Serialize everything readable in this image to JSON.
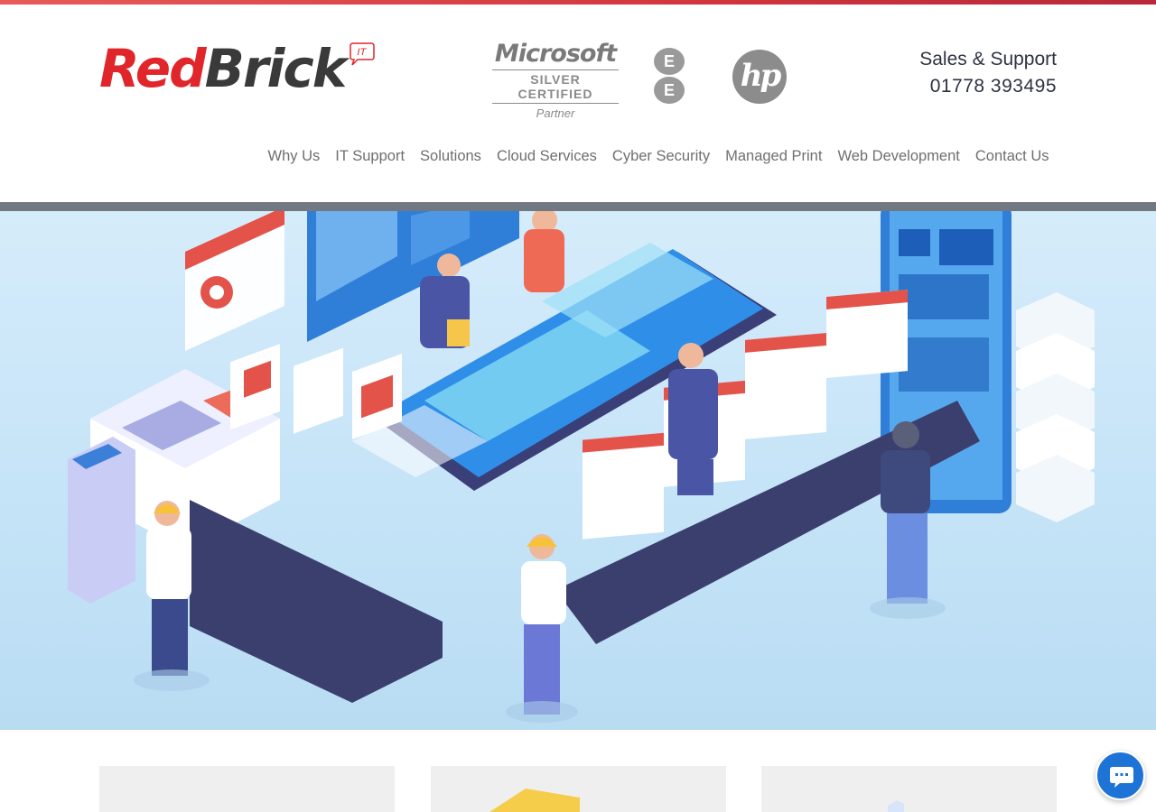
{
  "brand": {
    "logo_part1": "Red",
    "logo_part2": "Brick",
    "logo_badge": "IT"
  },
  "partners": {
    "microsoft_name": "Microsoft",
    "microsoft_level": "SILVER CERTIFIED",
    "microsoft_partner": "Partner",
    "ee_letter_top": "E",
    "ee_letter_bottom": "E",
    "hp_text": "hp"
  },
  "contact": {
    "label": "Sales & Support",
    "phone": "01778 393495"
  },
  "nav": {
    "items": [
      {
        "label": "Why Us"
      },
      {
        "label": "IT Support"
      },
      {
        "label": "Solutions"
      },
      {
        "label": "Cloud Services"
      },
      {
        "label": "Cyber Security"
      },
      {
        "label": "Managed Print"
      },
      {
        "label": "Web Development"
      },
      {
        "label": "Contact Us"
      }
    ]
  },
  "colors": {
    "brand_red": "#e0262b",
    "brand_dark": "#3a3a3a",
    "nav_text": "#6f6f6f",
    "contact_text": "#2f3243",
    "hero_bg": "#c4e3f7",
    "chat_button": "#1e73d6"
  },
  "icons": {
    "chat": "chat-bubble-icon",
    "hero": "hero-illustration"
  }
}
